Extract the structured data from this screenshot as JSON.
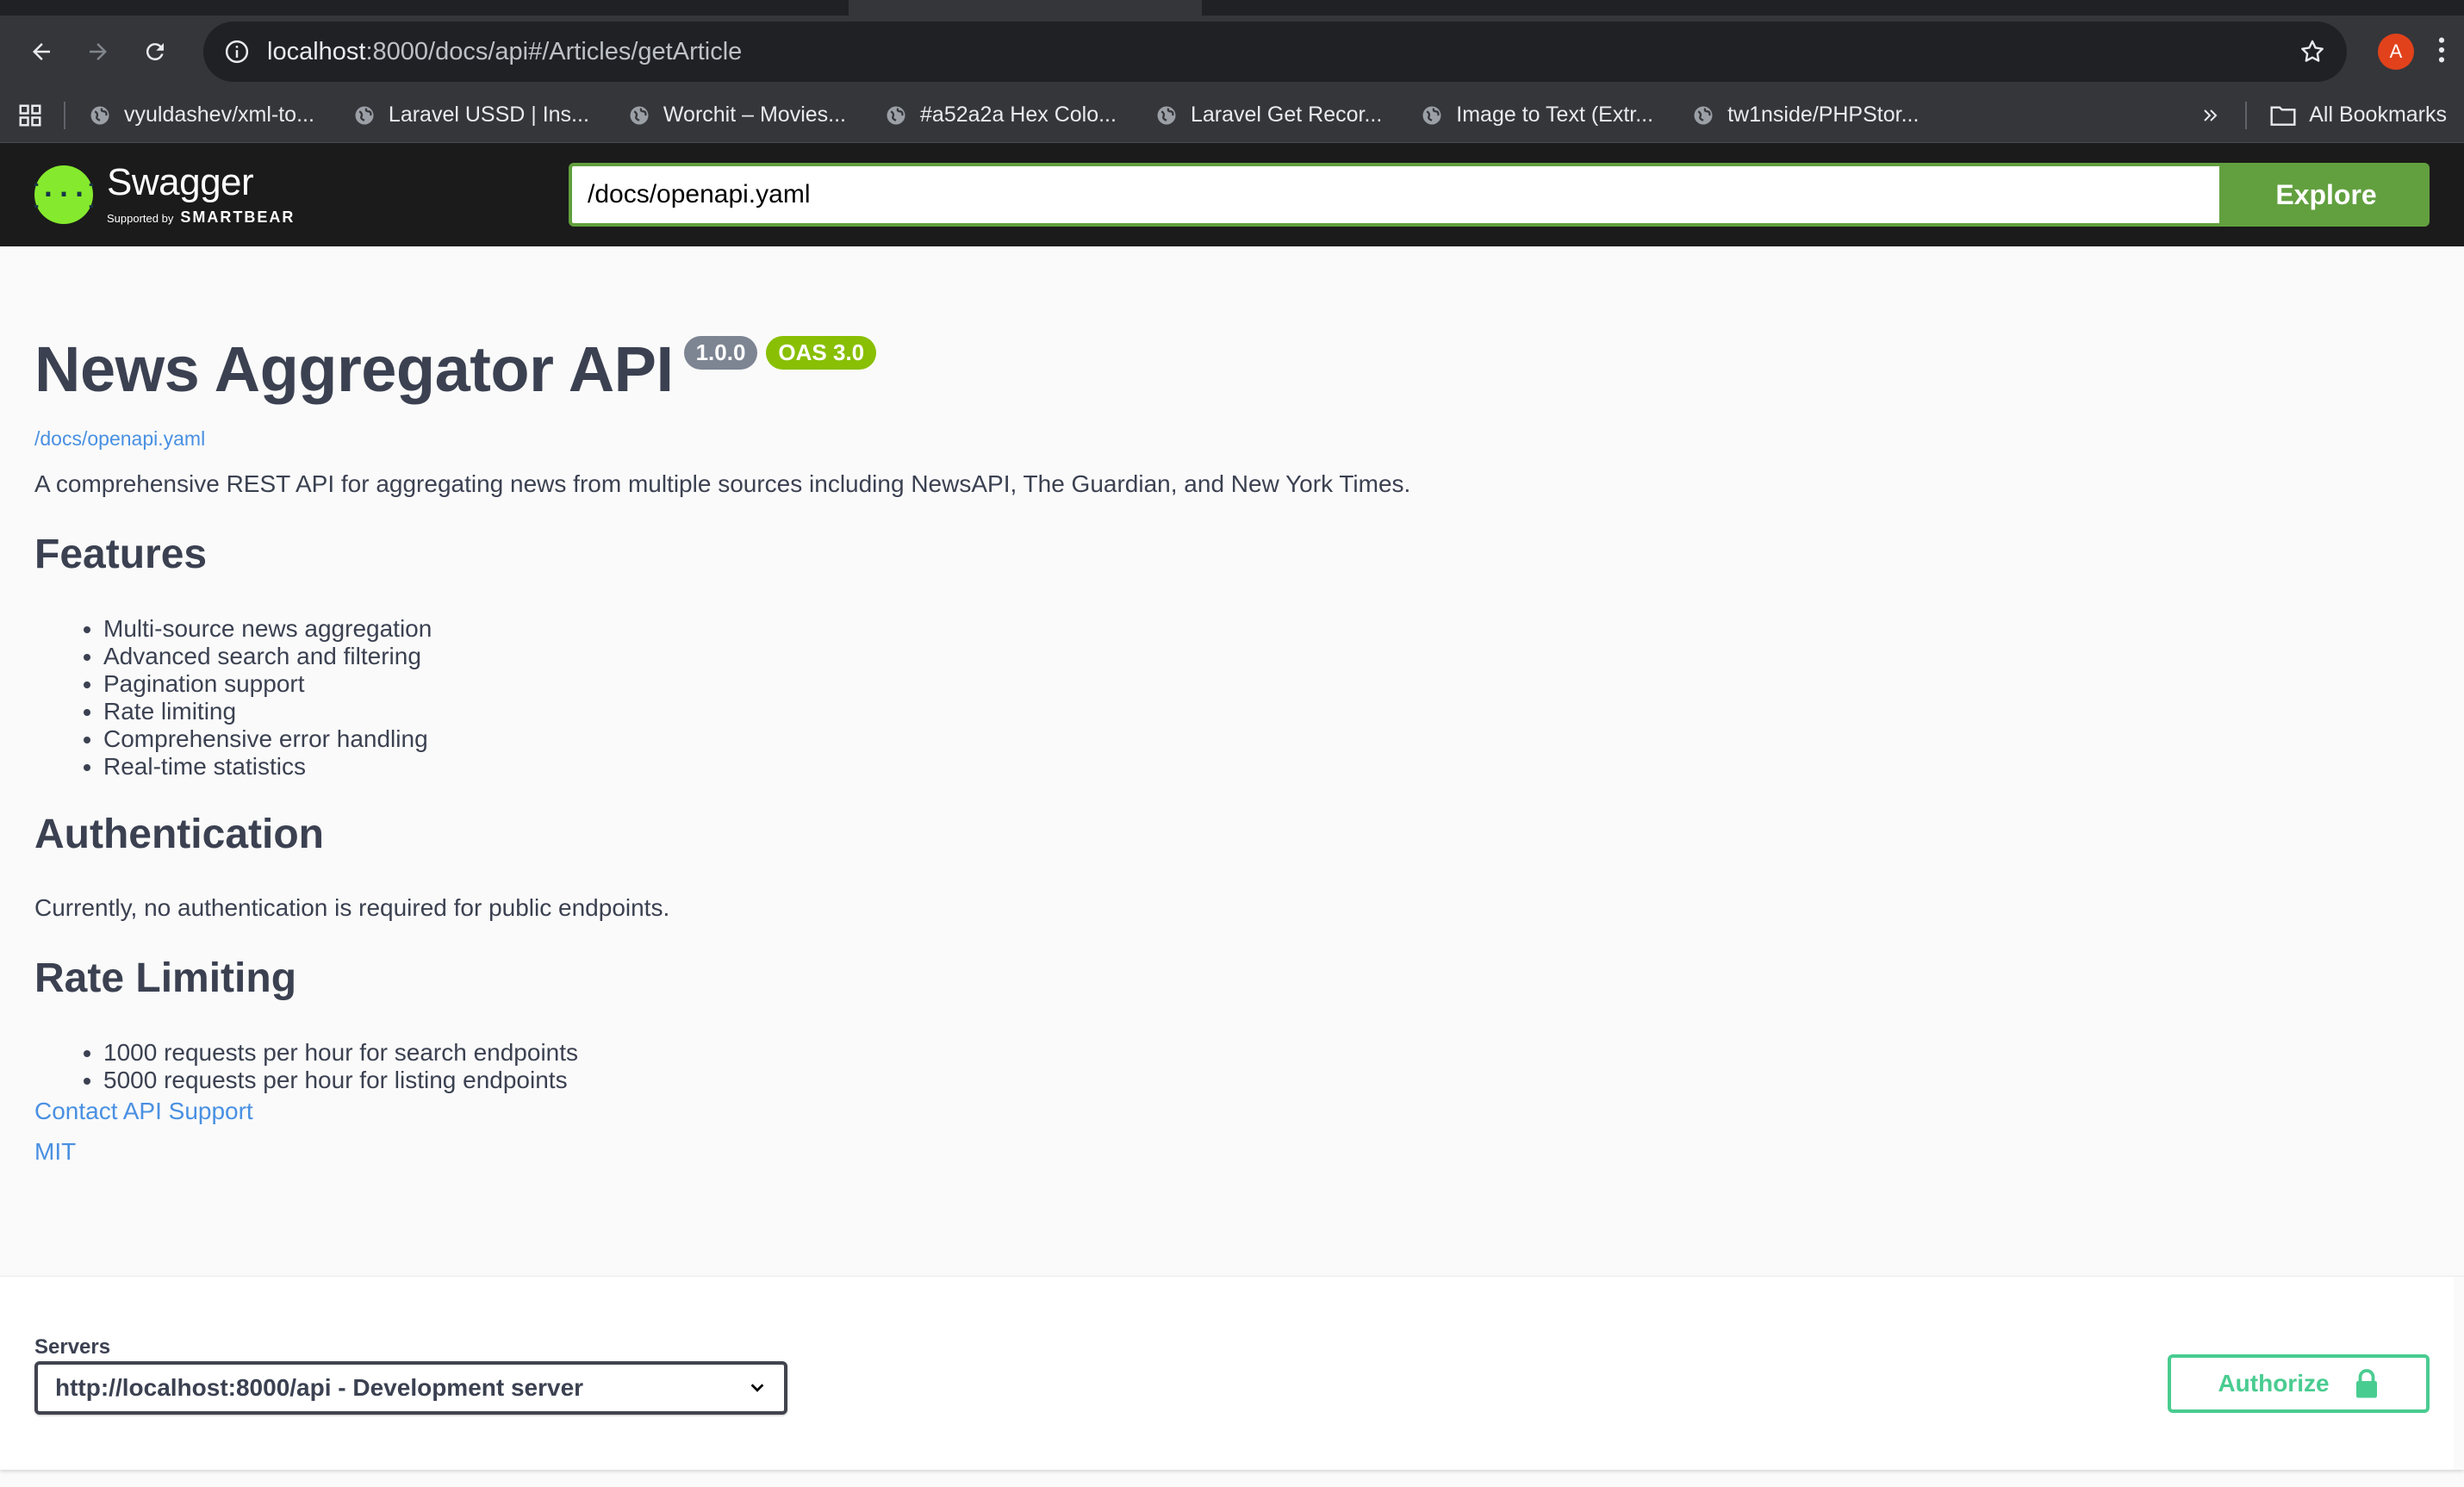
{
  "browser": {
    "url_host": "localhost",
    "url_path": ":8000/docs/api#/Articles/getArticle",
    "profile_initial": "A",
    "bookmarks": [
      {
        "label": "vyuldashev/xml-to..."
      },
      {
        "label": "Laravel USSD | Ins..."
      },
      {
        "label": "Worchit – Movies..."
      },
      {
        "label": "#a52a2a Hex Colo..."
      },
      {
        "label": "Laravel Get Recor..."
      },
      {
        "label": "Image to Text (Extr..."
      },
      {
        "label": "tw1nside/PHPStor..."
      }
    ],
    "all_bookmarks_label": "All Bookmarks"
  },
  "swagger": {
    "logo_name": "Swagger",
    "logo_supported_by": "Supported by",
    "logo_smartbear": "SMARTBEAR",
    "spec_url_value": "/docs/openapi.yaml",
    "explore_label": "Explore"
  },
  "info": {
    "title": "News Aggregator API",
    "version_badge": "1.0.0",
    "oas_badge": "OAS 3.0",
    "spec_link": "/docs/openapi.yaml",
    "description": "A comprehensive REST API for aggregating news from multiple sources including NewsAPI, The Guardian, and New York Times.",
    "features_heading": "Features",
    "features": [
      "Multi-source news aggregation",
      "Advanced search and filtering",
      "Pagination support",
      "Rate limiting",
      "Comprehensive error handling",
      "Real-time statistics"
    ],
    "auth_heading": "Authentication",
    "auth_text": "Currently, no authentication is required for public endpoints.",
    "rate_heading": "Rate Limiting",
    "rate_items": [
      "1000 requests per hour for search endpoints",
      "5000 requests per hour for listing endpoints"
    ],
    "contact_link": "Contact API Support",
    "license_link": "MIT"
  },
  "servers": {
    "label": "Servers",
    "selected": "http://localhost:8000/api - Development server",
    "authorize_label": "Authorize"
  },
  "colors": {
    "swagger_green": "#62a03f",
    "badge_grey": "#7d8492",
    "oas_green": "#89bf04",
    "authorize_green": "#49cc90",
    "link_blue": "#4990e2",
    "text_dark": "#3b4151"
  }
}
